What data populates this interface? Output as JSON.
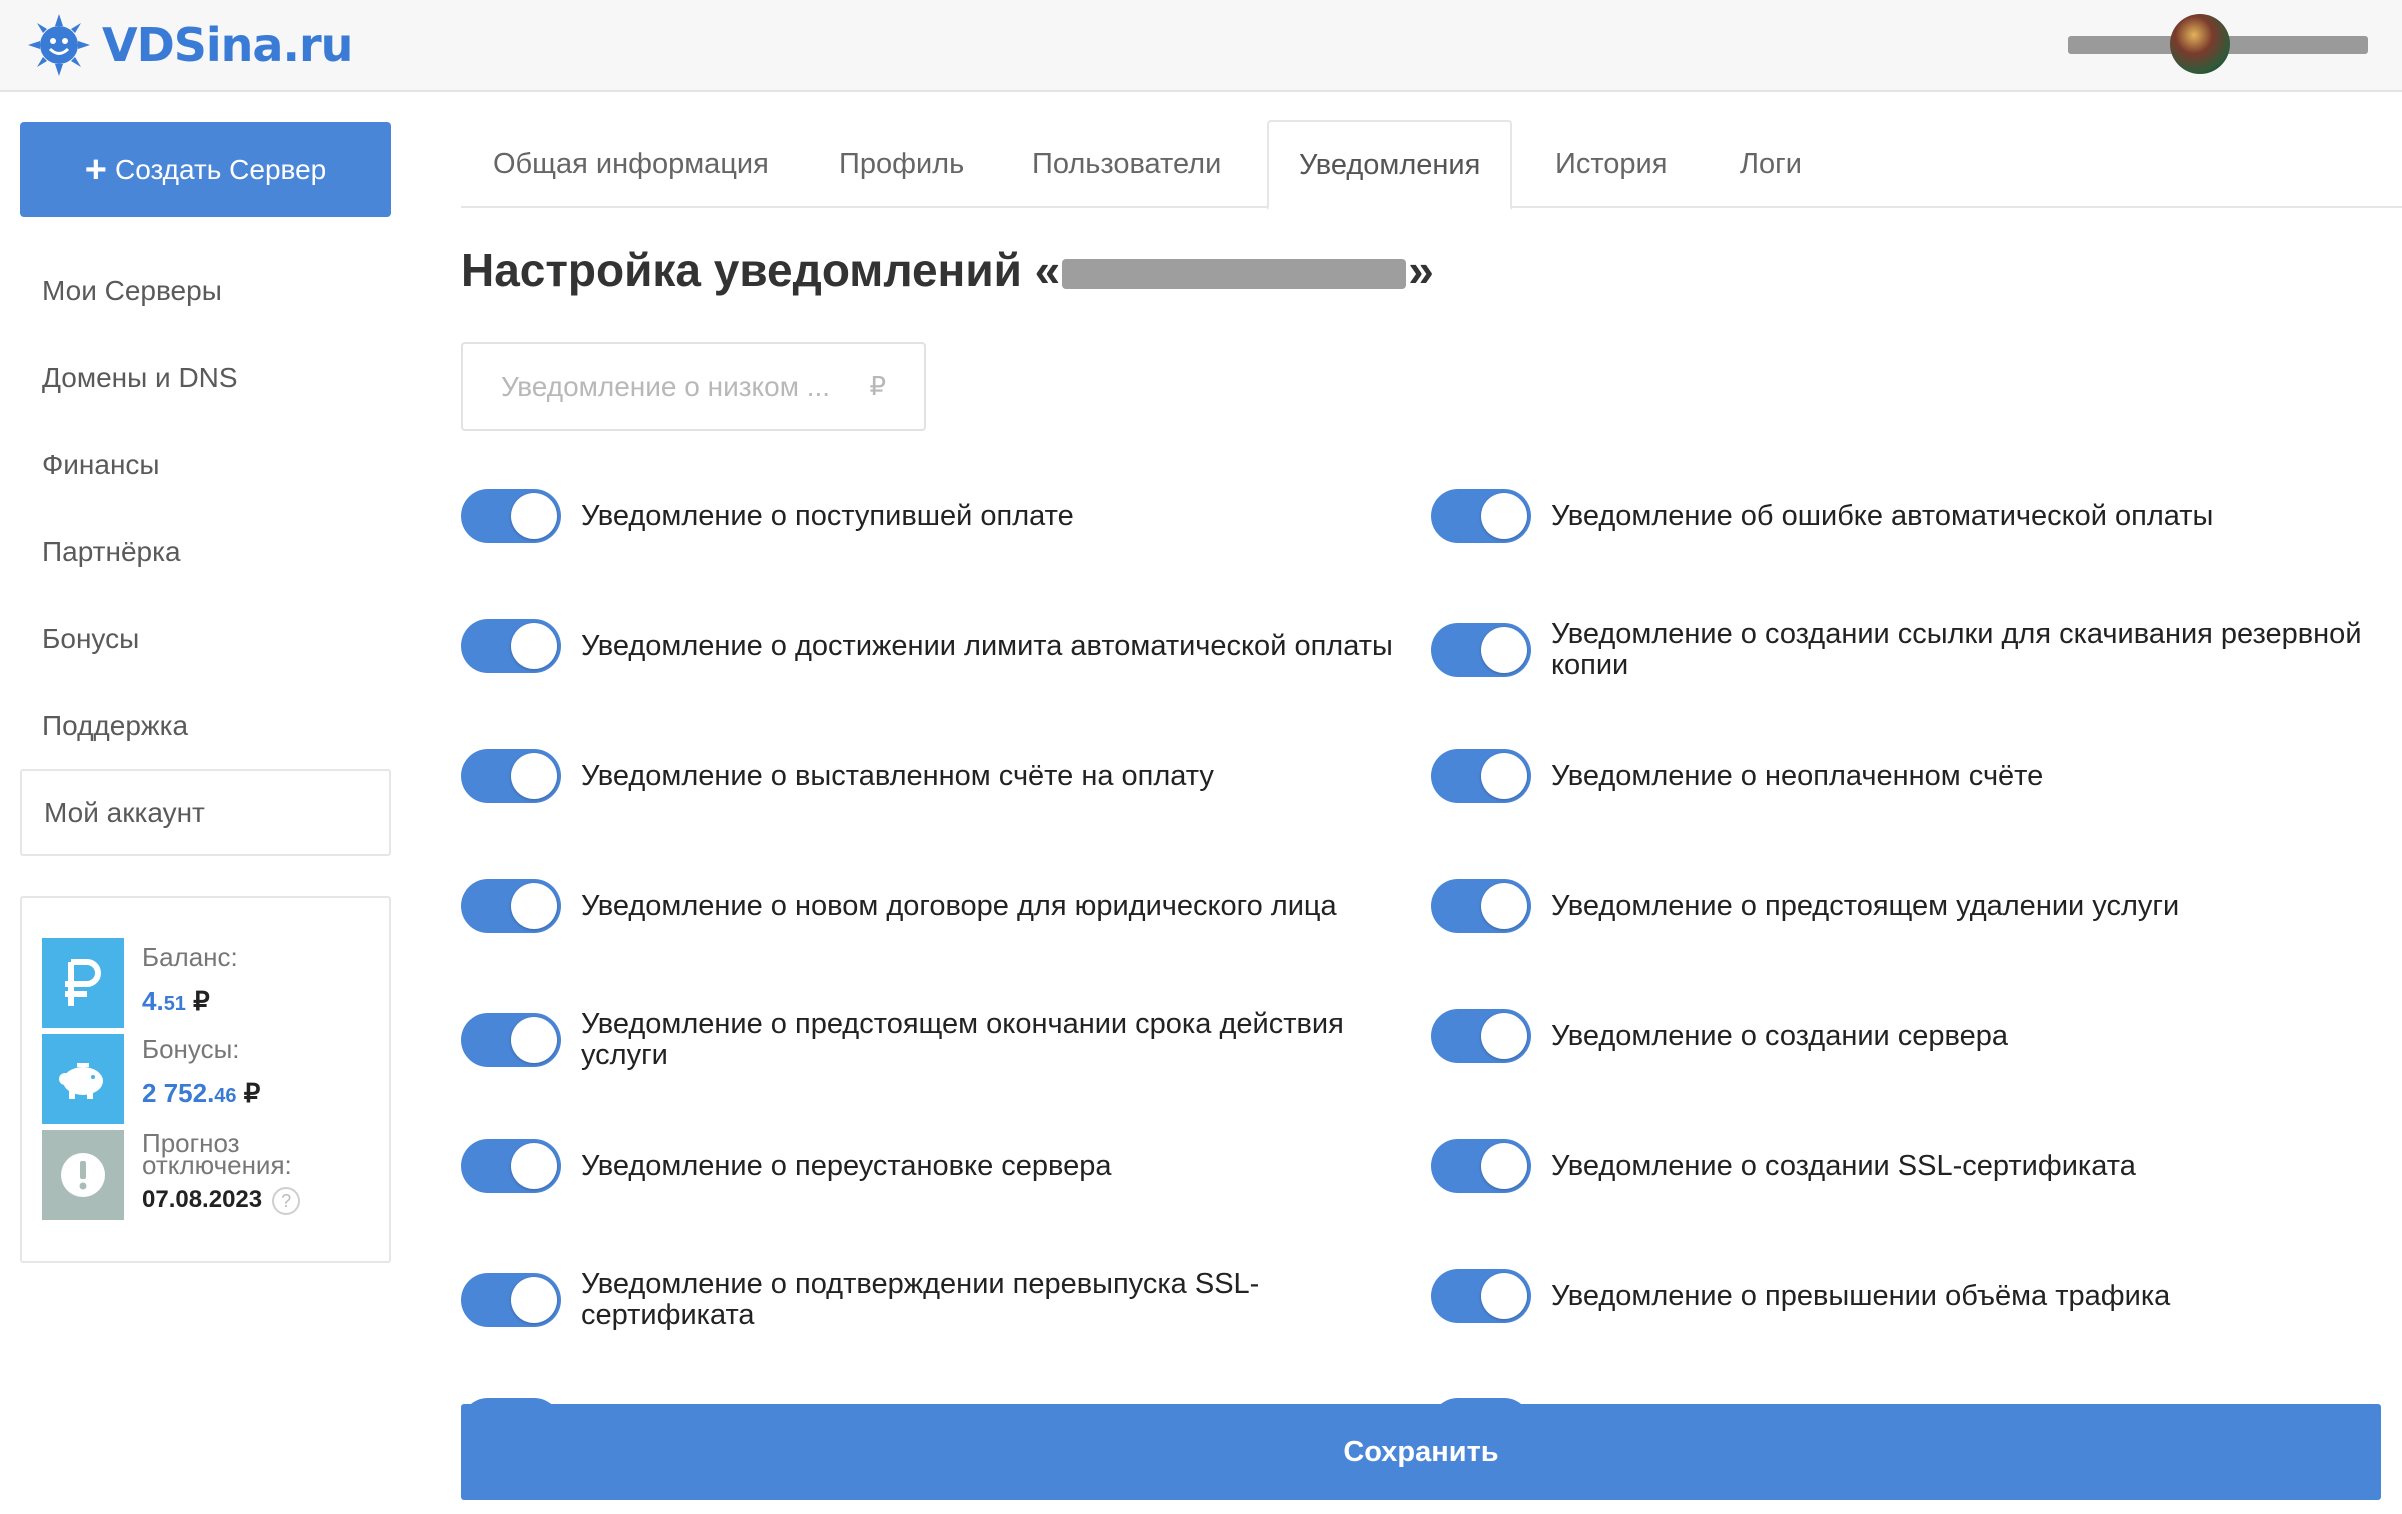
{
  "header": {
    "logo_text": "VDSina.ru",
    "logo_icon": "sun-mascot-icon",
    "user_avatar": "avatar"
  },
  "sidebar": {
    "create_button": "Создать Сервер",
    "items": [
      {
        "label": "Мои Серверы"
      },
      {
        "label": "Домены и DNS"
      },
      {
        "label": "Финансы"
      },
      {
        "label": "Партнёрка"
      },
      {
        "label": "Бонусы"
      },
      {
        "label": "Поддержка"
      },
      {
        "label": "Мой аккаунт",
        "active": true
      }
    ],
    "balance": {
      "label": "Баланс:",
      "int": "4.",
      "cents": "51",
      "currency": "₽",
      "icon": "ruble-icon"
    },
    "bonuses": {
      "label": "Бонусы:",
      "int": "2 752.",
      "cents": "46",
      "currency": "₽",
      "icon": "piggy-bank-icon"
    },
    "forecast": {
      "label_line1": "Прогноз",
      "label_line2": "отключения:",
      "date": "07.08.2023",
      "help": "?",
      "icon": "warning-icon"
    }
  },
  "tabs": [
    {
      "label": "Общая информация"
    },
    {
      "label": "Профиль"
    },
    {
      "label": "Пользователи"
    },
    {
      "label": "Уведомления",
      "active": true
    },
    {
      "label": "История"
    },
    {
      "label": "Логи"
    }
  ],
  "main": {
    "title_prefix": "Настройка уведомлений «",
    "title_suffix": "»",
    "threshold_placeholder": "Уведомление о низком ...",
    "threshold_currency": "₽",
    "save_button": "Сохранить",
    "colors": {
      "accent": "#4a86d8"
    }
  },
  "toggles_left": [
    {
      "label": "Уведомление о поступившей оплате",
      "on": true
    },
    {
      "label": "Уведомление о достижении лимита автоматической оплаты",
      "on": true
    },
    {
      "label": "Уведомление о выставленном счёте на оплату",
      "on": true
    },
    {
      "label": "Уведомление о новом договоре для юридического лица",
      "on": true
    },
    {
      "label": "Уведомление о предстоящем окончании срока действия услуги",
      "on": true
    },
    {
      "label": "Уведомление о переустановке сервера",
      "on": true
    },
    {
      "label": "Уведомление о подтверждении перевыпуска SSL-сертификата",
      "on": true
    }
  ],
  "toggles_right": [
    {
      "label": "Уведомление об ошибке автоматической оплаты",
      "on": true
    },
    {
      "label": "Уведомление о создании ссылки для скачивания резервной копии",
      "on": true
    },
    {
      "label": "Уведомление о неоплаченном счёте",
      "on": true
    },
    {
      "label": "Уведомление о предстоящем удалении услуги",
      "on": true
    },
    {
      "label": "Уведомление о создании сервера",
      "on": true
    },
    {
      "label": "Уведомление о создании SSL-сертификата",
      "on": true
    },
    {
      "label": "Уведомление о превышении объёма трафика",
      "on": true
    }
  ]
}
